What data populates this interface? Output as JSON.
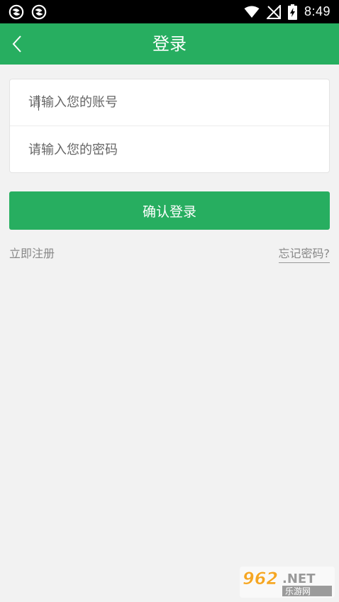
{
  "status_bar": {
    "time": "8:49",
    "icons": [
      "app-notification-icon",
      "app-notification-icon",
      "wifi-icon",
      "no-signal-icon",
      "battery-charging-icon"
    ]
  },
  "app_bar": {
    "title": "登录",
    "back_icon": "chevron-left-icon"
  },
  "form": {
    "account_placeholder": "请输入您的账号",
    "password_placeholder": "请输入您的密码"
  },
  "actions": {
    "login_label": "确认登录",
    "register_label": "立即注册",
    "forgot_label": "忘记密码?"
  },
  "watermark": {
    "text": "962.NET",
    "subtext": "乐游网"
  },
  "colors": {
    "primary": "#27ae60",
    "background": "#f2f2f2",
    "status_bar": "#000000"
  }
}
